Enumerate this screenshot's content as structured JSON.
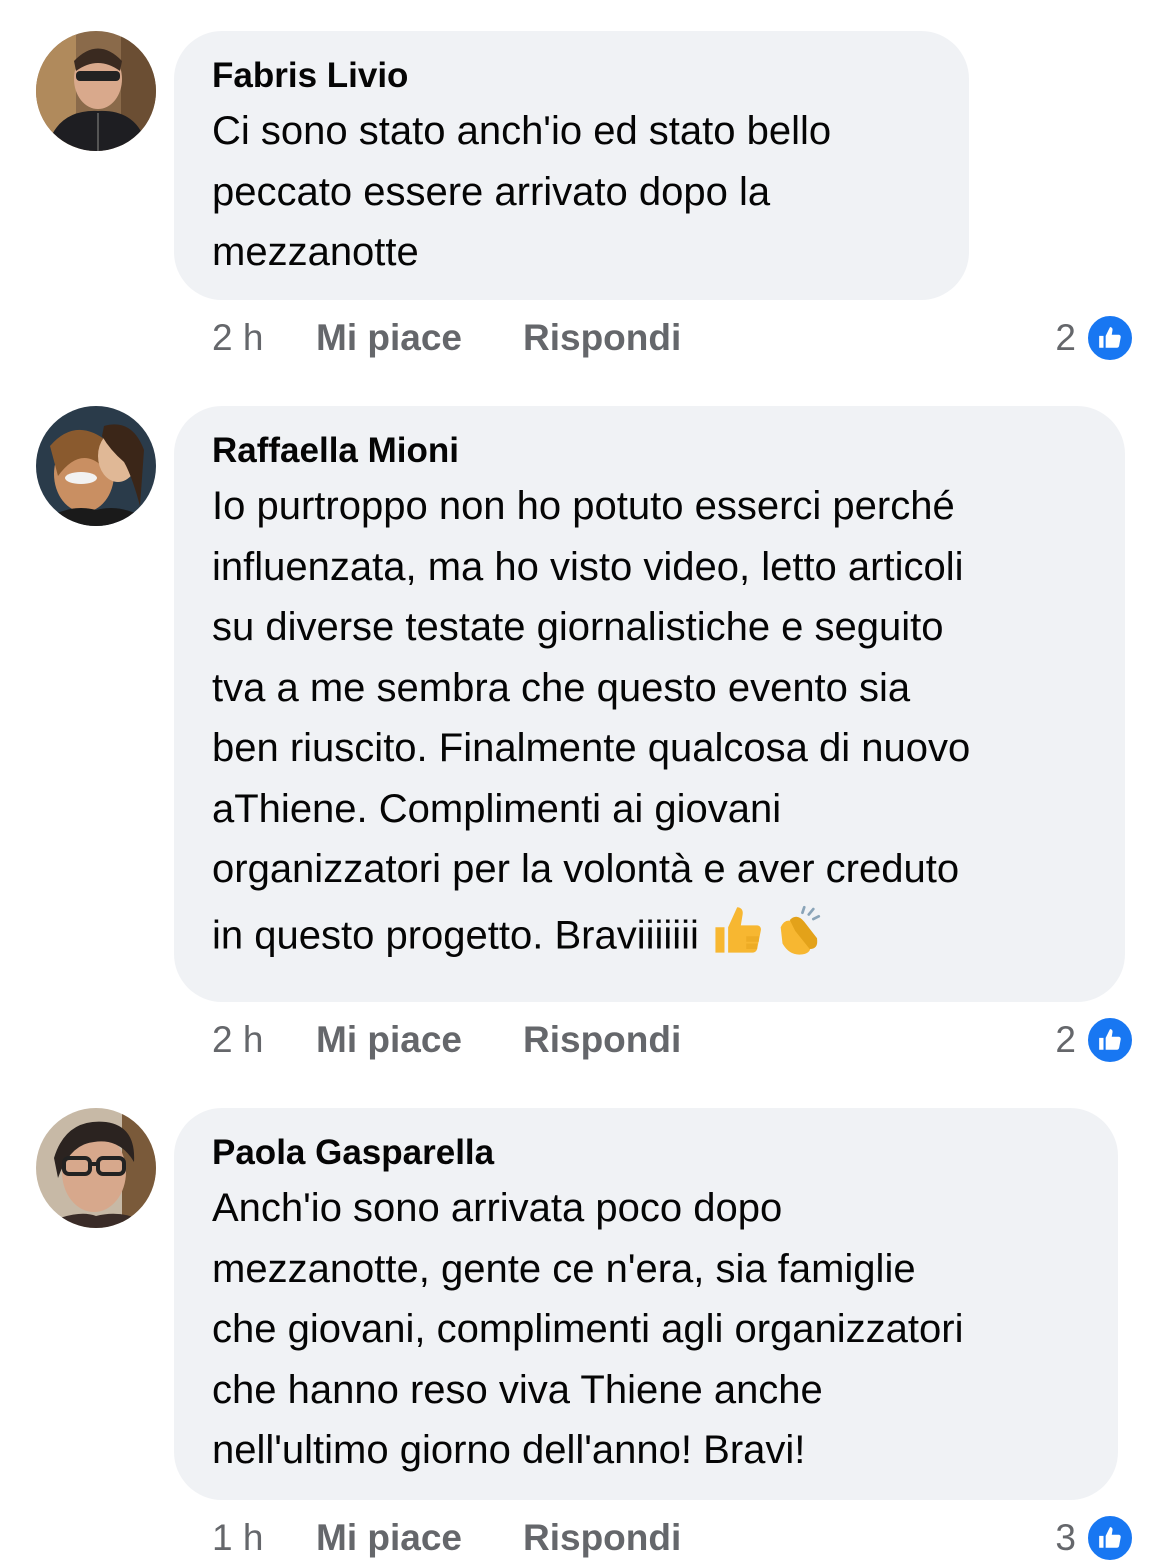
{
  "comments": [
    {
      "author": "Fabris Livio",
      "text": "Ci sono stato anch'io ed stato bello\npeccato essere arrivato dopo la\nmezzanotte",
      "time": "2 h",
      "like_label": "Mi piace",
      "reply_label": "Rispondi",
      "reactions": "2"
    },
    {
      "author": "Raffaella Mioni",
      "text": "Io purtroppo non ho potuto esserci perché\ninfluenzata, ma ho visto video, letto articoli\nsu diverse testate giornalistiche e seguito\ntva a me sembra che questo evento sia\nben riuscito. Finalmente qualcosa di nuovo\naThiene. Complimenti ai giovani\norganizzatori per la volontà e aver creduto\nin questo progetto. Braviiiiiii",
      "emojis": [
        "thumbs-up-icon",
        "clapping-hands-icon"
      ],
      "time": "2 h",
      "like_label": "Mi piace",
      "reply_label": "Rispondi",
      "reactions": "2"
    },
    {
      "author": "Paola Gasparella",
      "text": "Anch'io sono arrivata  poco dopo\nmezzanotte, gente ce n'era, sia famiglie\nche giovani, complimenti agli organizzatori\nche hanno reso viva Thiene anche\nnell'ultimo giorno dell'anno! Bravi!",
      "time": "1 h",
      "like_label": "Mi piace",
      "reply_label": "Rispondi",
      "reactions": "3"
    }
  ],
  "colors": {
    "bubble": "#f0f2f5",
    "meta_text": "#65676b",
    "like_blue": "#1877f2"
  }
}
